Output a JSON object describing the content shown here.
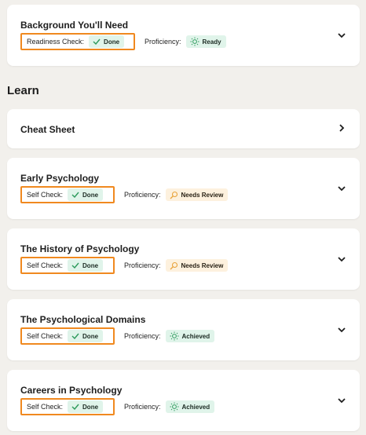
{
  "background": {
    "title": "Background You'll Need",
    "check_label": "Readiness Check:",
    "check_value": "Done",
    "proficiency_label": "Proficiency:",
    "proficiency_value": "Ready"
  },
  "learn": {
    "heading": "Learn"
  },
  "cheat_sheet": {
    "title": "Cheat Sheet"
  },
  "modules": [
    {
      "title": "Early Psychology",
      "check_label": "Self Check:",
      "check_value": "Done",
      "proficiency_label": "Proficiency:",
      "proficiency_value": "Needs Review",
      "proficiency_status": "needs-review"
    },
    {
      "title": "The History of Psychology",
      "check_label": "Self Check:",
      "check_value": "Done",
      "proficiency_label": "Proficiency:",
      "proficiency_value": "Needs Review",
      "proficiency_status": "needs-review"
    },
    {
      "title": "The Psychological Domains",
      "check_label": "Self Check:",
      "check_value": "Done",
      "proficiency_label": "Proficiency:",
      "proficiency_value": "Achieved",
      "proficiency_status": "achieved"
    },
    {
      "title": "Careers in Psychology",
      "check_label": "Self Check:",
      "check_value": "Done",
      "proficiency_label": "Proficiency:",
      "proficiency_value": "Achieved",
      "proficiency_status": "achieved"
    }
  ],
  "colors": {
    "highlight_border": "#f0891f",
    "done_badge_bg": "#e0f4ea",
    "review_badge_bg": "#fdf1de",
    "check_icon": "#2c9a5b",
    "review_icon": "#e8a23a"
  },
  "icons": {
    "done": "checkmark-icon",
    "ready": "lightbulb-icon",
    "achieved": "lightbulb-icon",
    "needs_review": "magnifier-icon",
    "expand": "chevron-down-icon",
    "open": "chevron-right-icon"
  }
}
